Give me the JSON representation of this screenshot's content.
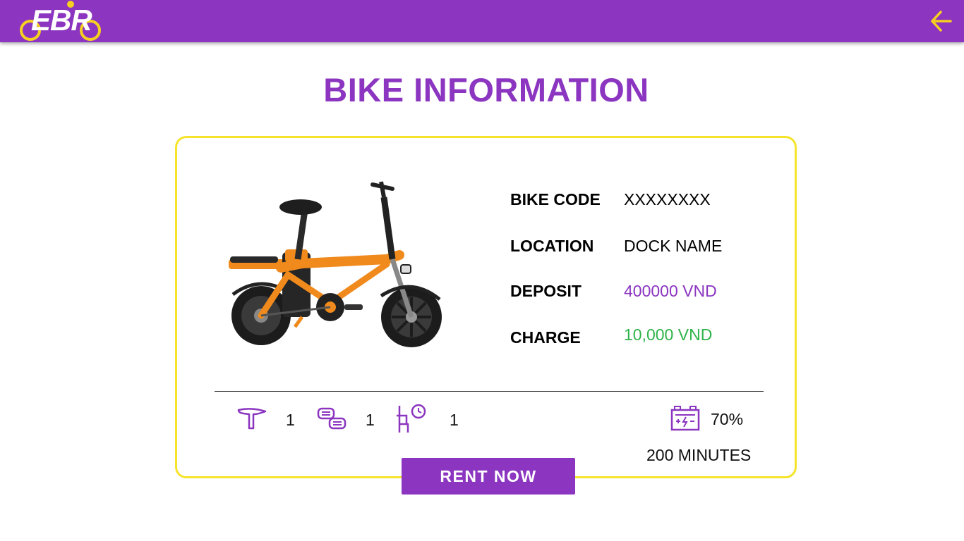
{
  "header": {
    "logo_text": "EBR",
    "back_icon": "arrow-left-icon",
    "bar_color": "#8b35c0",
    "accent_color": "#f5d020"
  },
  "page": {
    "title": "BIKE INFORMATION"
  },
  "bike": {
    "image_desc": "orange-folding-electric-bike",
    "fields": [
      {
        "label": "BIKE CODE",
        "value": "XXXXXXXX",
        "value_color": "#000000"
      },
      {
        "label": "LOCATION",
        "value": "DOCK NAME",
        "value_color": "#000000"
      },
      {
        "label": "DEPOSIT",
        "value": "400000 VND",
        "value_color": "#8b35c0"
      },
      {
        "label": "CHARGE",
        "value": "10,000 VND",
        "value_color": "#2fb34a"
      }
    ]
  },
  "stats": {
    "saddle": {
      "icon": "saddle-icon",
      "count": "1"
    },
    "pedals": {
      "icon": "pedal-icon",
      "count": "1"
    },
    "seat_time": {
      "icon": "seat-clock-icon",
      "count": "1"
    },
    "battery": {
      "icon": "battery-icon",
      "percent": "70%",
      "remaining": "200 MINUTES"
    }
  },
  "actions": {
    "rent_label": "RENT NOW"
  }
}
